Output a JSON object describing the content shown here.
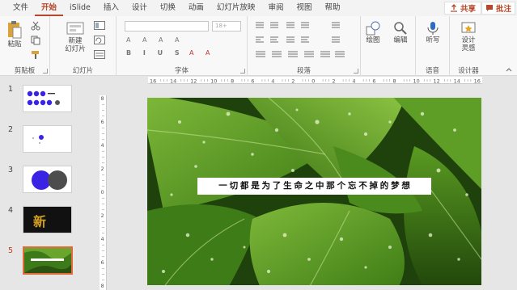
{
  "menu": {
    "tabs": [
      "文件",
      "开始",
      "iSlide",
      "插入",
      "设计",
      "切换",
      "动画",
      "幻灯片放映",
      "审阅",
      "视图",
      "帮助"
    ],
    "active_tab": "开始",
    "share_label": "共享",
    "comment_label": "批注"
  },
  "ribbon": {
    "paste_label": "粘贴",
    "clipboard_group": "剪贴板",
    "new_slide_label": "新建\n幻灯片",
    "slides_group": "幻灯片",
    "font_size": "18+",
    "font_group": "字体",
    "paragraph_group": "段落",
    "drawing_label": "绘图",
    "editing_label": "编辑",
    "dictate_label": "听写",
    "voice_group": "语音",
    "designer_label": "设计\n灵感",
    "designer_group": "设计器"
  },
  "slides": [
    {
      "number": "1"
    },
    {
      "number": "2"
    },
    {
      "number": "3"
    },
    {
      "number": "4",
      "thumb_text": "新"
    },
    {
      "number": "5"
    }
  ],
  "selected_slide": "5",
  "ruler": {
    "h_labels": [
      "16",
      "14",
      "12",
      "10",
      "8",
      "6",
      "4",
      "2",
      "0",
      "2",
      "4",
      "6",
      "8",
      "10",
      "12",
      "14",
      "16"
    ],
    "v_labels": [
      "8",
      "6",
      "4",
      "2",
      "0",
      "2",
      "4",
      "6",
      "8"
    ]
  },
  "slide_content": {
    "caption": "一切都是为了生命之中那个忘不掉的梦想"
  },
  "colors": {
    "accent": "#b7472a",
    "thumb_blue": "#3b23e6",
    "thumb_gray": "#4d4d4d",
    "leaf_green": "#4f8f22"
  }
}
